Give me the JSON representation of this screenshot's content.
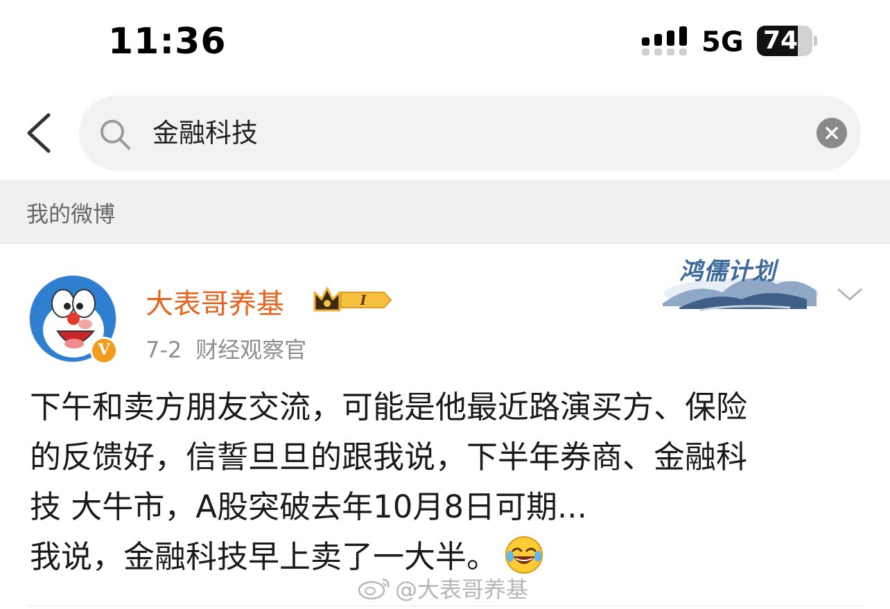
{
  "status_bar": {
    "time": "11:36",
    "network": "5G",
    "battery_percent": "74",
    "battery_level": 0.74,
    "signal_bars_active": 4
  },
  "search": {
    "query": "金融科技"
  },
  "section": {
    "title": "我的微博"
  },
  "post": {
    "author": "大表哥养基",
    "vip_level": "I",
    "date": "7-2",
    "source": "财经观察官",
    "card_decoration_text": "鸿儒计划",
    "body_lines": [
      "下午和卖方朋友交流，可能是他最近路演买方、保险",
      "的反馈好，信誓旦旦的跟我说，下半年券商、金融科",
      "技 大牛市，A股突破去年10月8日可期...",
      "我说，金融科技早上卖了一大半。"
    ],
    "emoji": "laugh-cry-emoji"
  },
  "watermark": {
    "text": "@大表哥养基"
  },
  "colors": {
    "username": "#e8631d",
    "meta": "#8d8d8d",
    "section_bg": "#f0f0f0",
    "search_bg": "#f2f2f2",
    "verified": "#f39b1b"
  }
}
